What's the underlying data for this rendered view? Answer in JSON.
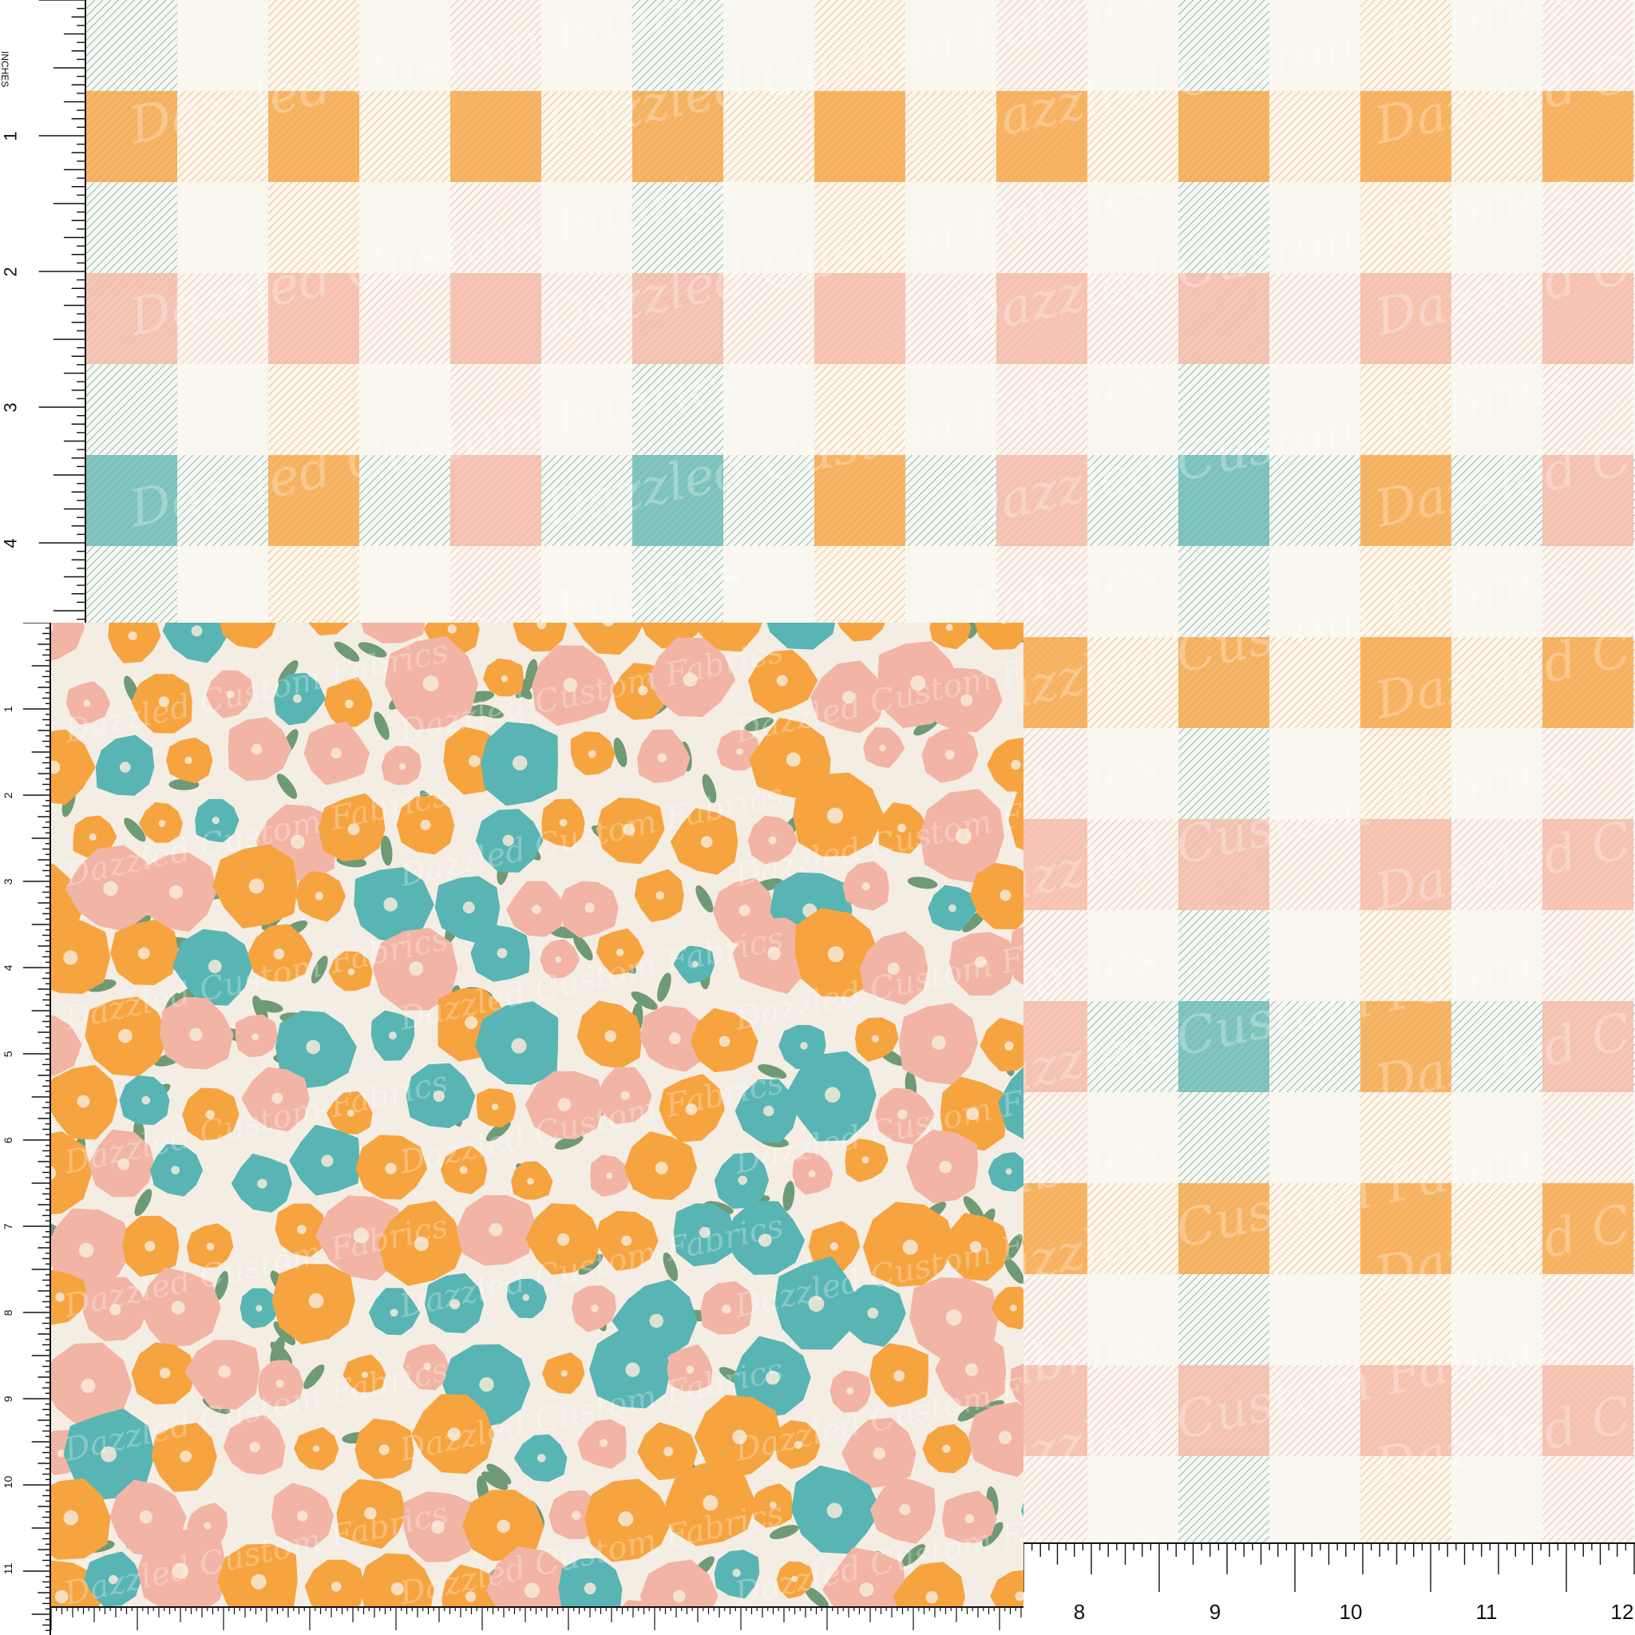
{
  "image": {
    "description": "Fabric swatch preview: gingham plaid background with a floral pattern inset, framed by inch rulers",
    "watermark_text": "Dazzled Custom Fabrics"
  },
  "plaid": {
    "colors": {
      "base": "#faf7f1",
      "teal": "#6fbcb7",
      "orange": "#f6a94f",
      "pink": "#f4bcaa",
      "stripe_teal": "#5aa9a6",
      "stripe_pink": "#efae9c"
    }
  },
  "floral": {
    "colors": {
      "background": "#f4ede4",
      "orange": "#f6a440",
      "pink": "#f2b4a4",
      "teal": "#58b5b3",
      "leaf": "#6f9a76",
      "center": "#f6ead8"
    }
  },
  "rulers": {
    "top_left_label": "INCHES",
    "left_numbers": [
      "1",
      "2",
      "3",
      "4"
    ],
    "floral_left_numbers": [
      "1",
      "2",
      "3",
      "4",
      "5",
      "6",
      "7",
      "8",
      "9",
      "10",
      "11"
    ],
    "bottom_numbers": [
      "8",
      "9",
      "10",
      "11",
      "12"
    ]
  }
}
